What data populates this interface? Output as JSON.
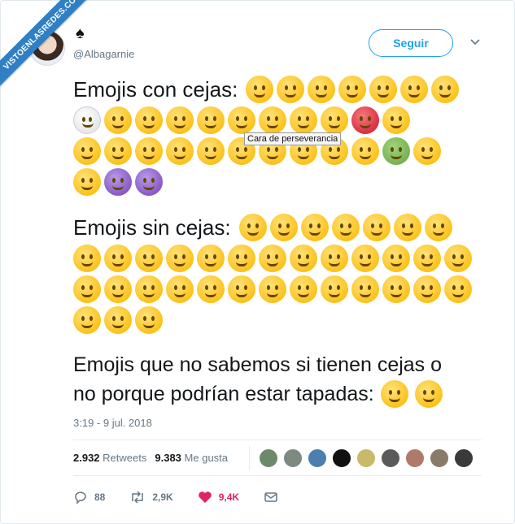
{
  "watermark": "VISTOENLASREDES.COM",
  "user": {
    "handle": "@Albagarnie",
    "follow_label": "Seguir"
  },
  "sections": [
    {
      "text": "Emojis con cejas:",
      "rows": [
        [
          "yellow",
          "yellow",
          "yellow",
          "yellow",
          "yellow",
          "yellow",
          "yellow"
        ],
        [
          "white",
          "yellow",
          "yellow",
          "yellow",
          "yellow",
          "yellow",
          "yellow",
          "yellow",
          "yellow",
          "red",
          "yellow"
        ],
        [
          "yellow",
          "yellow",
          "yellow",
          "yellow",
          "yellow",
          "yellow",
          "yellow",
          "yellow",
          "yellow",
          "yellow",
          "green",
          "yellow"
        ],
        [
          "yellow",
          "purple",
          "purple"
        ]
      ]
    },
    {
      "text": "Emojis sin cejas:",
      "rows": [
        [
          "yellow",
          "yellow",
          "yellow",
          "yellow",
          "yellow",
          "yellow",
          "yellow"
        ],
        [
          "yellow",
          "yellow",
          "yellow",
          "yellow",
          "yellow",
          "yellow",
          "yellow",
          "yellow",
          "yellow",
          "yellow",
          "yellow",
          "yellow",
          "yellow"
        ],
        [
          "yellow",
          "yellow",
          "yellow",
          "yellow",
          "yellow",
          "yellow",
          "yellow",
          "yellow",
          "yellow",
          "yellow",
          "yellow",
          "yellow",
          "yellow"
        ],
        [
          "yellow",
          "yellow",
          "yellow"
        ]
      ]
    }
  ],
  "third_text_line1": "Emojis que no sabemos si tienen cejas o",
  "third_text_line2": "no porque podrían estar tapadas:",
  "tooltip": "Cara de perseverancia",
  "timestamp": "3:19 - 9 jul. 2018",
  "stats": {
    "retweets_count": "2.932",
    "retweets_label": "Retweets",
    "likes_count": "9.383",
    "likes_label": "Me gusta"
  },
  "actions": {
    "replies": "88",
    "retweets": "2,9K",
    "likes": "9,4K"
  },
  "colors": {
    "accent": "#1da1f2",
    "like": "#e0245e",
    "emoji": "#fcc21b"
  }
}
